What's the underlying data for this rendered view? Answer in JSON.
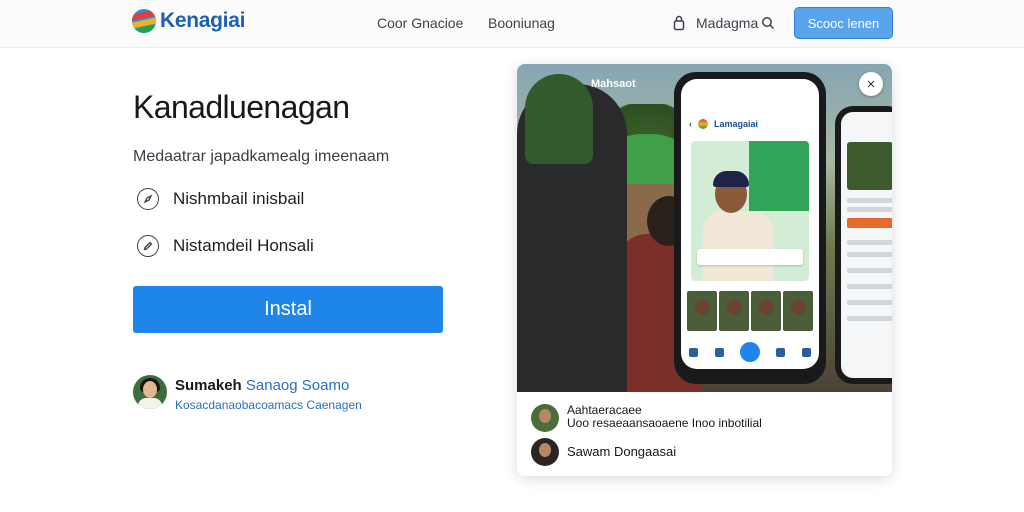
{
  "header": {
    "logo_text": "Kenagiai",
    "nav": [
      "Coor Gnacioe",
      "Booniunag",
      "Madagma"
    ],
    "cta": "Scooc lenen"
  },
  "hero": {
    "title": "Kanadluenagan",
    "subtitle": "Medaatrar japadkamealg imeenaam",
    "features": [
      "Nishmbail inisbail",
      "Nistamdeil Honsali"
    ],
    "install_label": "Instal"
  },
  "testimonial": {
    "name_bold": "Sumakeh",
    "name_link": "Sanaog Soamo",
    "subtitle": "Kosacdanaobacoamacs Caenagen"
  },
  "preview": {
    "photo_label": "Mahsaot",
    "close_glyph": "×",
    "phone_header": "Lamagaiai",
    "comments": [
      {
        "name": "Aahtaeracaee",
        "text": "Uoo resaeaansaoaene Inoo inbotilial"
      },
      {
        "name": "Sawam Dongaasai",
        "text": ""
      }
    ]
  },
  "colors": {
    "accent": "#1e86ea",
    "brand_blue": "#1d5fb7",
    "link_blue": "#2a6fc0",
    "cta_top_bg": "#5aa4ec"
  },
  "icons": {
    "logo": "logo-mark-icon",
    "lock": "lock-icon",
    "search": "search-icon",
    "feature_1": "compass-icon",
    "feature_2": "edit-icon",
    "close": "close-icon"
  }
}
